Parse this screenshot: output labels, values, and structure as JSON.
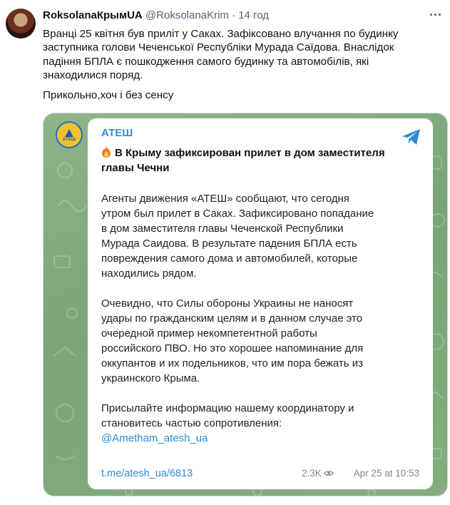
{
  "tweet": {
    "author_name": "RoksolanaКрымUA",
    "handle": "@RoksolanaKrim",
    "separator": "·",
    "time": "14 год",
    "text_lines": [
      "Вранці 25 квітня був приліт у Саках. Зафіксовано влучання по будинку",
      "заступника голови Чеченської Республіки Мурада Саїдова. Внаслідок",
      "падіння БПЛА є пошкодження самого будинку та автомобілів, які",
      "знаходилися поряд."
    ],
    "text_last": "Прикольно,хоч і без сенсу"
  },
  "telegram": {
    "channel_name": "АТЕШ",
    "avatar_label": "АТЕШ",
    "headline_lines": [
      "В Крыму зафиксирован прилет в дом заместителя",
      "главы Чечни"
    ],
    "para1": [
      "Агенты движения «АТЕШ» сообщают, что сегодня",
      "утром был прилет в Саках. Зафиксировано попадание",
      "в дом заместителя главы Чеченской Республики",
      "Мурада Саидова. В результате падения БПЛА есть",
      "повреждения самого дома и автомобилей, которые",
      "находились рядом."
    ],
    "para2": [
      "Очевидно, что Силы обороны Украины не наносят",
      "удары по гражданским целям и в данном случае это",
      "очередной пример некомпетентной работы",
      "российского ПВО. Но это хорошее напоминание для",
      "оккупантов и их подельников, что им пора бежать из",
      "украинского Крыма."
    ],
    "para3": [
      "Присылайте информацию нашему координатору и",
      "становитесь частью сопротивления:"
    ],
    "coordinator_link": "@Ametham_atesh_ua",
    "post_link": "t.me/atesh_ua/6813",
    "views": "2.3K",
    "date": "Apr 25 at 10:53"
  },
  "colors": {
    "link_blue": "#2e8bd6",
    "bg_green": "#86ad7f",
    "muted_gray": "#536471"
  },
  "icons": [
    "more-icon",
    "telegram-icon",
    "fire-icon",
    "eye-icon"
  ]
}
